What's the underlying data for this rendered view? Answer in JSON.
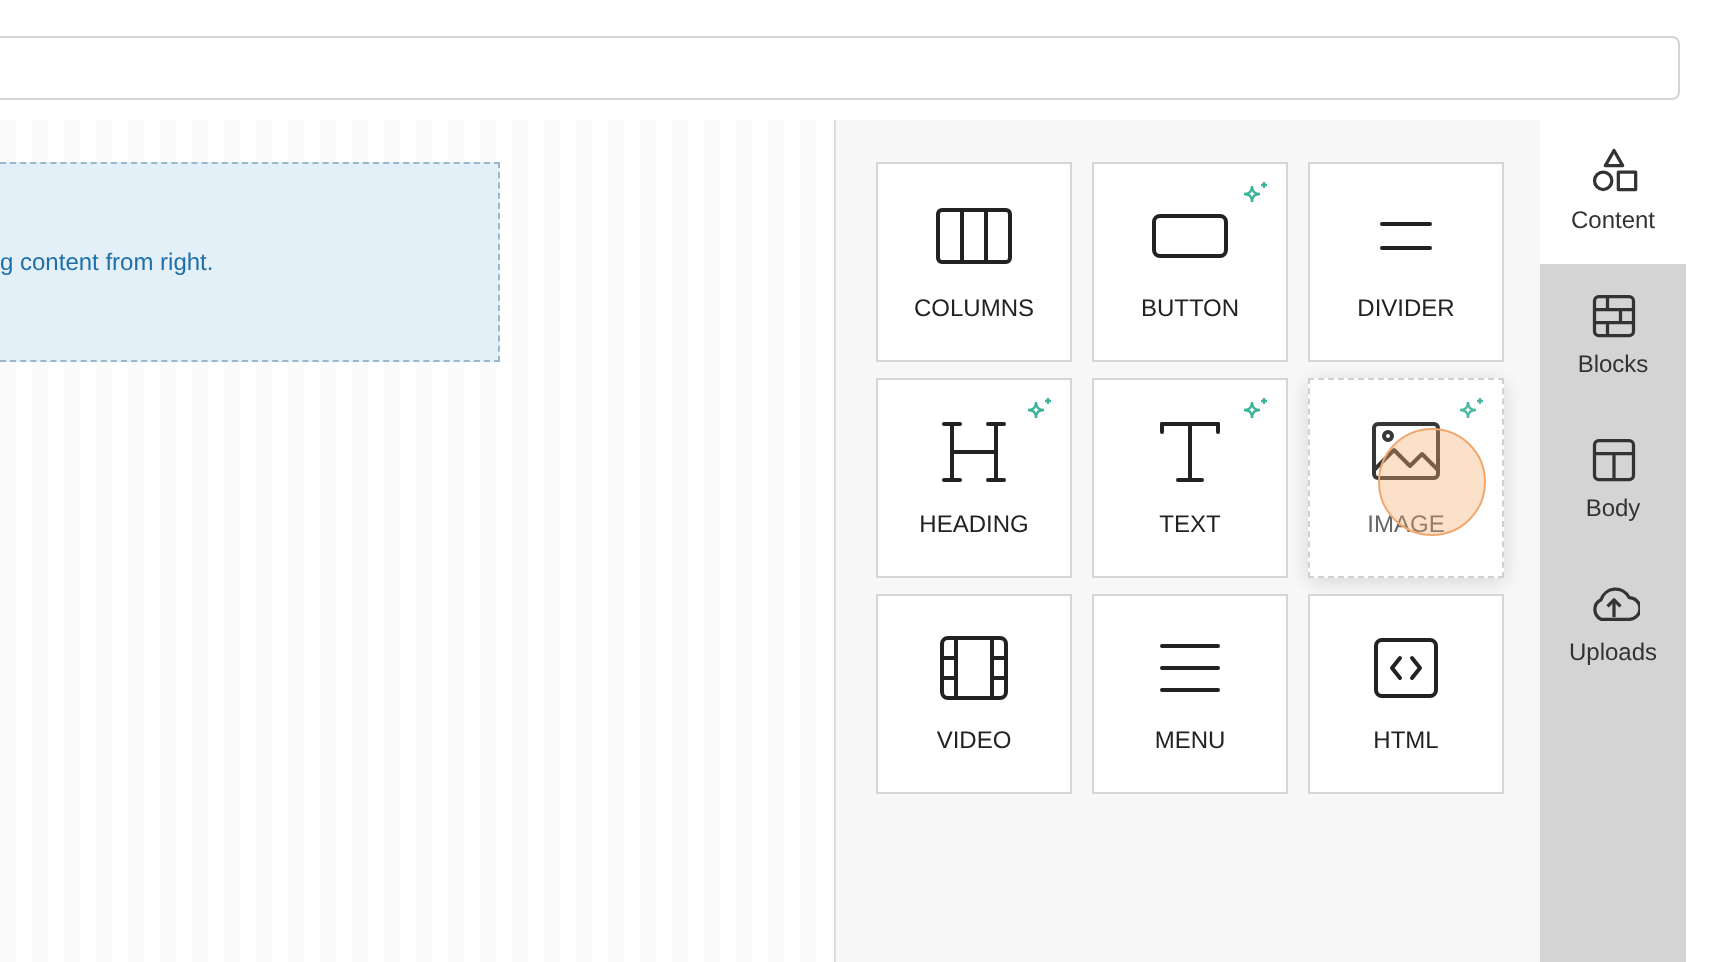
{
  "canvas": {
    "hint": "g content from right."
  },
  "blocks": [
    {
      "kind": "columns",
      "label": "COLUMNS",
      "ai": false,
      "dragging": false
    },
    {
      "kind": "button",
      "label": "BUTTON",
      "ai": true,
      "dragging": false
    },
    {
      "kind": "divider",
      "label": "DIVIDER",
      "ai": false,
      "dragging": false
    },
    {
      "kind": "heading",
      "label": "HEADING",
      "ai": true,
      "dragging": false
    },
    {
      "kind": "text",
      "label": "TEXT",
      "ai": true,
      "dragging": false
    },
    {
      "kind": "image",
      "label": "IMAGE",
      "ai": true,
      "dragging": true
    },
    {
      "kind": "video",
      "label": "VIDEO",
      "ai": false,
      "dragging": false
    },
    {
      "kind": "menu",
      "label": "MENU",
      "ai": false,
      "dragging": false
    },
    {
      "kind": "html",
      "label": "HTML",
      "ai": false,
      "dragging": false
    }
  ],
  "tabs": [
    {
      "kind": "content",
      "label": "Content",
      "selected": true
    },
    {
      "kind": "blocks",
      "label": "Blocks",
      "selected": false
    },
    {
      "kind": "body",
      "label": "Body",
      "selected": false
    },
    {
      "kind": "uploads",
      "label": "Uploads",
      "selected": false
    }
  ]
}
